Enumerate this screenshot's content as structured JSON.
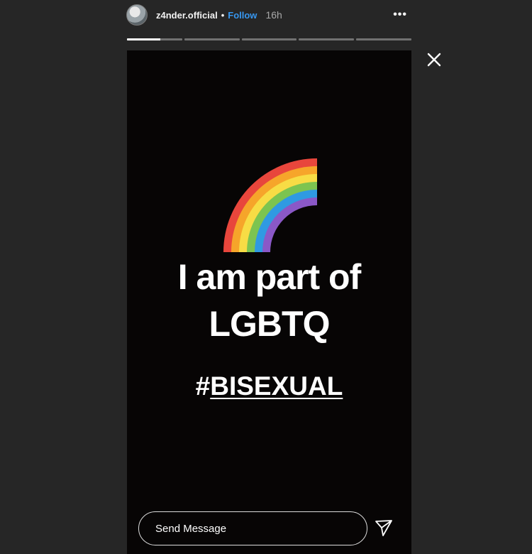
{
  "header": {
    "username": "z4nder.official",
    "separator": "•",
    "follow_label": "Follow",
    "time": "16h",
    "more_label": "•••"
  },
  "progress": {
    "segments": 5,
    "current_segment_fraction": 0.6
  },
  "story": {
    "emoji": "rainbow",
    "line1": "I am part of",
    "line2": "LGBTQ",
    "hashtag_hash": "#",
    "hashtag_text": "BISEXUAL",
    "background": "#070505"
  },
  "reply": {
    "placeholder": "Send Message"
  },
  "icons": {
    "close": "close-icon",
    "send": "send-icon",
    "more": "more-options-icon"
  },
  "colors": {
    "page_bg": "#262626",
    "follow": "#3797f0"
  }
}
